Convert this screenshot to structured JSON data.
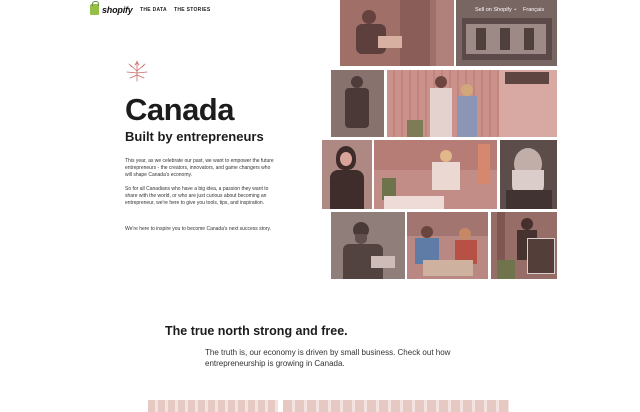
{
  "nav": {
    "logo_text": "shopify",
    "links": [
      "THE DATA",
      "THE STORIES"
    ],
    "sell": "Sell on Shopify",
    "lang": "Français"
  },
  "hero": {
    "title": "Canada",
    "subtitle": "Built by entrepreneurs",
    "paragraphs": [
      "This year, as we celebrate our past, we want to empower the future entrepreneurs - the creators, innovators, and game changers who will shape Canada's economy.",
      "So for all Canadians who have a big idea, a passion they want to share with the world, or who are just curious about becoming an entrepreneur, we're here to give you tools, tips, and inspiration.",
      "We're here to inspire you to become Canada's next success story."
    ]
  },
  "section": {
    "title": "The true north strong and free.",
    "text": "The truth is, our economy is driven by small business. Check out how entrepreneurship is growing in Canada."
  },
  "colors": {
    "accent": "#c56a64",
    "photo_tint": "#d67870"
  },
  "icons": [
    "maple-leaf-icon",
    "shopify-bag-icon",
    "chevron-down-icon"
  ]
}
